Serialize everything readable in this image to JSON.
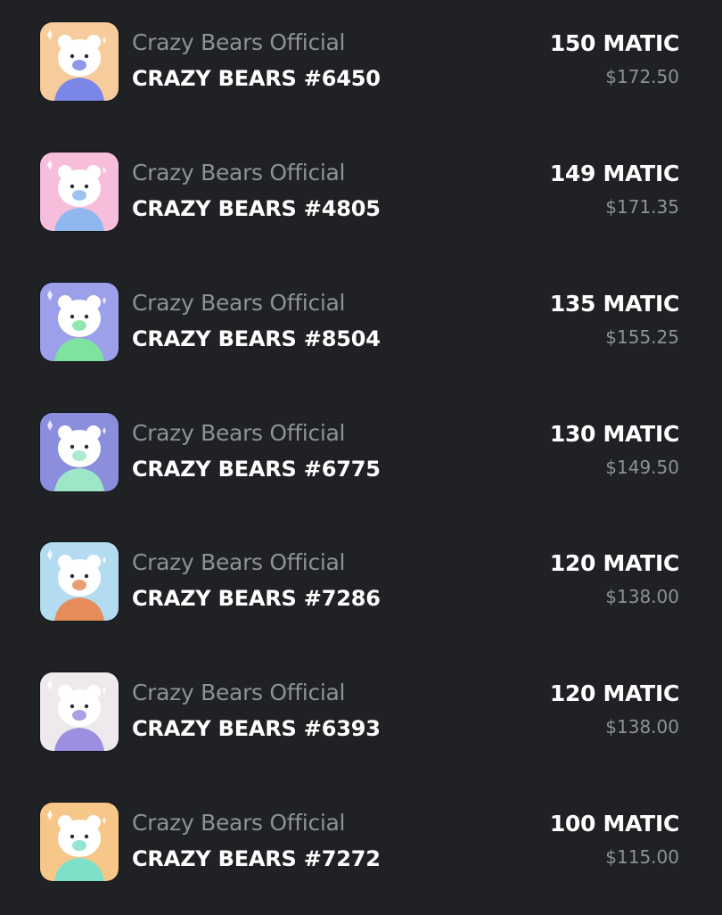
{
  "listings": [
    {
      "collection": "Crazy Bears Official",
      "name": "CRAZY BEARS #6450",
      "price": "150 MATIC",
      "usd": "$172.50",
      "bg": "#f6c58f",
      "accent": "#7a86e8",
      "image_icon": "bear-nft-icon"
    },
    {
      "collection": "Crazy Bears Official",
      "name": "CRAZY BEARS #4805",
      "price": "149 MATIC",
      "usd": "$171.35",
      "bg": "#f6b6d6",
      "accent": "#8fb7f0",
      "image_icon": "bear-nft-icon"
    },
    {
      "collection": "Crazy Bears Official",
      "name": "CRAZY BEARS #8504",
      "price": "135 MATIC",
      "usd": "$155.25",
      "bg": "#8f92e6",
      "accent": "#7fe3a0",
      "image_icon": "bear-nft-icon"
    },
    {
      "collection": "Crazy Bears Official",
      "name": "CRAZY BEARS #6775",
      "price": "130 MATIC",
      "usd": "$149.50",
      "bg": "#7c7fd8",
      "accent": "#9de7c6",
      "image_icon": "bear-nft-icon"
    },
    {
      "collection": "Crazy Bears Official",
      "name": "CRAZY BEARS #7286",
      "price": "120 MATIC",
      "usd": "$138.00",
      "bg": "#a9d8ee",
      "accent": "#e58c5a",
      "image_icon": "bear-nft-icon"
    },
    {
      "collection": "Crazy Bears Official",
      "name": "CRAZY BEARS #6393",
      "price": "120 MATIC",
      "usd": "$138.00",
      "bg": "#ece6ea",
      "accent": "#9a8fe0",
      "image_icon": "bear-nft-icon"
    },
    {
      "collection": "Crazy Bears Official",
      "name": "CRAZY BEARS #7272",
      "price": "100 MATIC",
      "usd": "$115.00",
      "bg": "#f6c07a",
      "accent": "#7ee0c9",
      "image_icon": "bear-nft-icon"
    }
  ]
}
